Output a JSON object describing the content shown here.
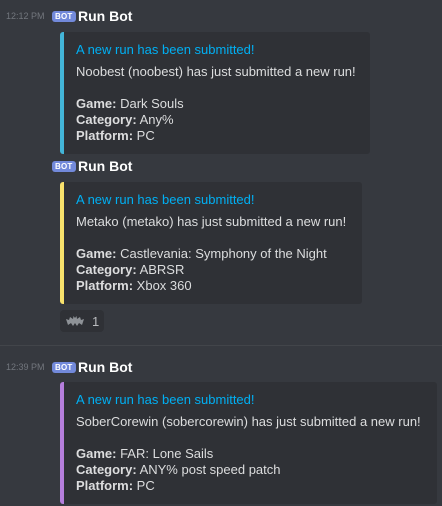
{
  "messages": [
    {
      "timestamp": "12:12 PM",
      "bot_tag": "BOT",
      "username": "Run Bot",
      "embed": {
        "title": "A new run has been submitted!",
        "description": "Noobest (noobest) has just submitted a new run!",
        "fields": [
          {
            "key": "Game:",
            "value": " Dark Souls"
          },
          {
            "key": "Category:",
            "value": " Any%"
          },
          {
            "key": "Platform:",
            "value": " PC"
          }
        ],
        "color": "#43b5d8"
      }
    },
    {
      "timestamp": "",
      "bot_tag": "BOT",
      "username": "Run Bot",
      "embed": {
        "title": "A new run has been submitted!",
        "description": "Metako (metako) has just submitted a new run!",
        "fields": [
          {
            "key": "Game:",
            "value": " Castlevania: Symphony of the Night"
          },
          {
            "key": "Category:",
            "value": " ABRSR"
          },
          {
            "key": "Platform:",
            "value": " Xbox 360"
          }
        ],
        "color": "#f8e16c"
      },
      "reaction": {
        "icon": "bat-emoji-icon",
        "count": "1"
      }
    },
    {
      "timestamp": "12:39 PM",
      "bot_tag": "BOT",
      "username": "Run Bot",
      "embed": {
        "title": "A new run has been submitted!",
        "description": "SoberCorewin (sobercorewin) has just submitted a new run!",
        "fields": [
          {
            "key": "Game:",
            "value": " FAR: Lone Sails"
          },
          {
            "key": "Category:",
            "value": " ANY% post speed patch"
          },
          {
            "key": "Platform:",
            "value": " PC"
          }
        ],
        "color": "#b57edc"
      }
    }
  ]
}
